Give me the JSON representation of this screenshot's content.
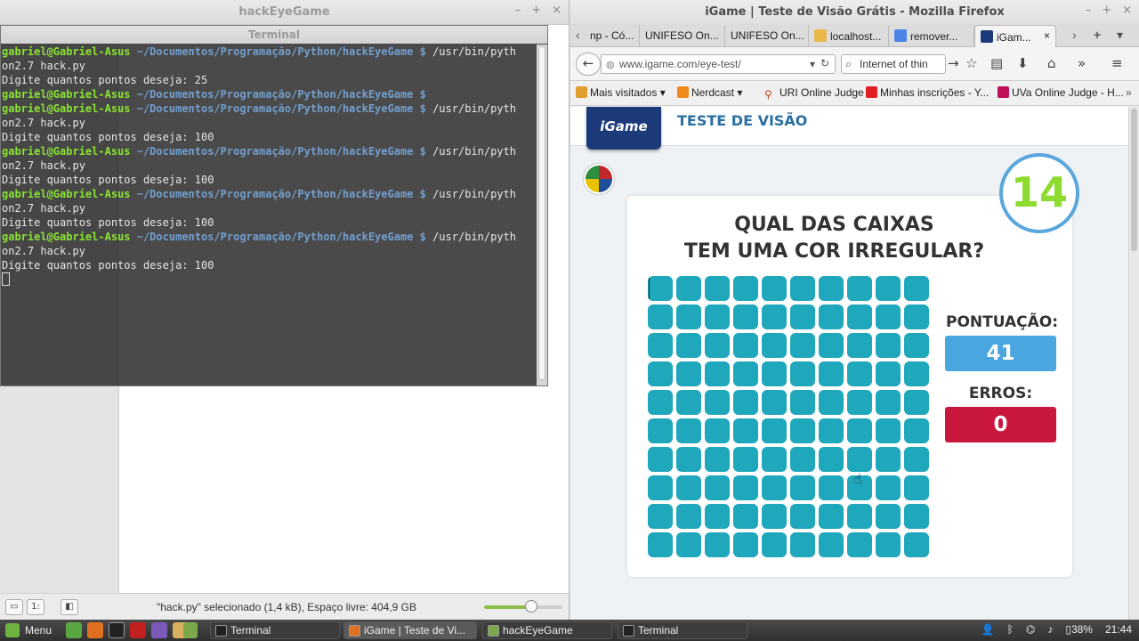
{
  "file_manager": {
    "title": "hackEyeGame",
    "status_text": "\"hack.py\" selecionado (1,4 kB), Espaço livre: 404,9 GB",
    "zoom_level": 0.6
  },
  "terminal": {
    "title": "Terminal",
    "user": "gabriel@Gabriel-Asus",
    "path": "~/Documentos/Programação/Python/hackEyeGame $",
    "lines": [
      {
        "kind": "prompt",
        "cmd": " /usr/bin/pyth",
        "wrap": "on2.7 hack.py"
      },
      {
        "kind": "output",
        "text": "Digite quantos pontos deseja: 25"
      },
      {
        "kind": "prompt",
        "cmd": "",
        "wrap": ""
      },
      {
        "kind": "prompt",
        "cmd": " /usr/bin/pyth",
        "wrap": "on2.7 hack.py"
      },
      {
        "kind": "output",
        "text": "Digite quantos pontos deseja: 100"
      },
      {
        "kind": "prompt",
        "cmd": " /usr/bin/pyth",
        "wrap": "on2.7 hack.py"
      },
      {
        "kind": "output",
        "text": "Digite quantos pontos deseja: 100"
      },
      {
        "kind": "prompt",
        "cmd": " /usr/bin/pyth",
        "wrap": "on2.7 hack.py"
      },
      {
        "kind": "output",
        "text": "Digite quantos pontos deseja: 100"
      },
      {
        "kind": "prompt",
        "cmd": " /usr/bin/pyth",
        "wrap": "on2.7 hack.py"
      },
      {
        "kind": "output",
        "text": "Digite quantos pontos deseja: 100"
      }
    ]
  },
  "firefox": {
    "title": "iGame | Teste de Visão Grátis - Mozilla Firefox",
    "tabs": [
      {
        "label": "np - Có...",
        "active": false
      },
      {
        "label": "UNIFESO On...",
        "active": false
      },
      {
        "label": "UNIFESO On...",
        "active": false
      },
      {
        "label": "localhost...",
        "active": false
      },
      {
        "label": "remover...",
        "active": false
      },
      {
        "label": "iGam...",
        "active": true
      }
    ],
    "url": "www.igame.com/eye-test/",
    "search": "Internet of thin",
    "bookmarks": [
      "Mais visitados",
      "Nerdcast",
      "URI Online Judge",
      "Minhas inscrições - Y...",
      "UVa Online Judge - H..."
    ]
  },
  "game": {
    "logo": "iGame",
    "heading": "TESTE DE VISÃO",
    "question_line1": "QUAL DAS CAIXAS",
    "question_line2": "TEM UMA COR IRREGULAR?",
    "timer": "14",
    "score_label": "PONTUAÇÃO:",
    "score": "41",
    "errors_label": "ERROS:",
    "errors": "0",
    "grid_rows": 10,
    "grid_cols": 10,
    "box_color": "#1fa7bc"
  },
  "taskbar": {
    "menu": "Menu",
    "tasks": [
      {
        "label": "Terminal",
        "active": false
      },
      {
        "label": "iGame | Teste de Vi...",
        "active": true
      },
      {
        "label": "hackEyeGame",
        "active": false
      },
      {
        "label": "Terminal",
        "active": false
      }
    ],
    "battery": "38%",
    "clock": "21:44"
  }
}
